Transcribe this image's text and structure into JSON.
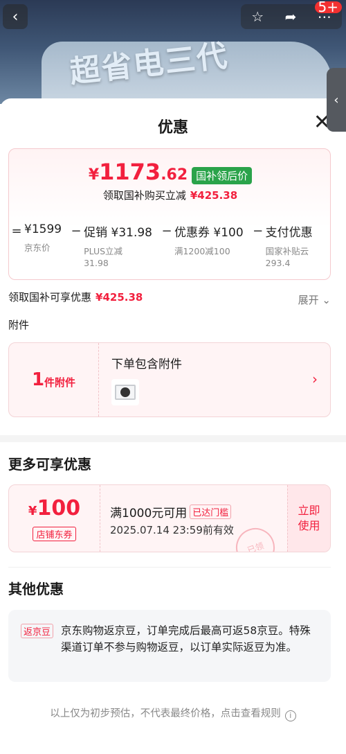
{
  "header": {
    "slogan": "超省电三代",
    "back_icon": "‹",
    "badge": "5+"
  },
  "sheet": {
    "title": "优惠",
    "close_icon": "✕"
  },
  "price_card": {
    "currency": "¥",
    "final_int": "1173",
    "final_dec": ".62",
    "tag": "国补领后价",
    "reduce_label": "领取国补购买立减",
    "reduce_amount": "¥425.38",
    "calc": [
      {
        "op": "=",
        "main": "¥1599",
        "sub": "京东价"
      },
      {
        "op": "−",
        "main": "促销 ¥31.98",
        "sub": "PLUS立减\n31.98"
      },
      {
        "op": "−",
        "main": "优惠券 ¥100",
        "sub": "满1200减100"
      },
      {
        "op": "−",
        "main": "支付优惠",
        "sub": "国家补贴云\n293.4"
      }
    ]
  },
  "enjoy": {
    "label": "领取国补可享优惠",
    "amount": "¥425.38",
    "expand_label": "展开"
  },
  "accessories": {
    "title": "附件",
    "count": "1",
    "unit": "件附件",
    "label": "下单包含附件"
  },
  "more": {
    "title": "更多可享优惠",
    "coupon": {
      "currency": "¥",
      "value": "100",
      "kind": "店铺东券",
      "condition": "满1000元可用",
      "met": "已达门槛",
      "expiry": "2025.07.14 23:59前有效",
      "stamp": "已领",
      "action_line1": "立即",
      "action_line2": "使用"
    }
  },
  "other": {
    "title": "其他优惠",
    "tag": "返京豆",
    "text": "京东购物返京豆，订单完成后最高可返58京豆。特殊渠道订单不参与购物返豆，以订单实际返豆为准。"
  },
  "footer": {
    "note": "以上仅为初步预估，不代表最终价格，点击查看规则",
    "info_icon": "i"
  },
  "colors": {
    "accent_red": "#f2203e",
    "subsidy_green": "#2aa34a"
  }
}
